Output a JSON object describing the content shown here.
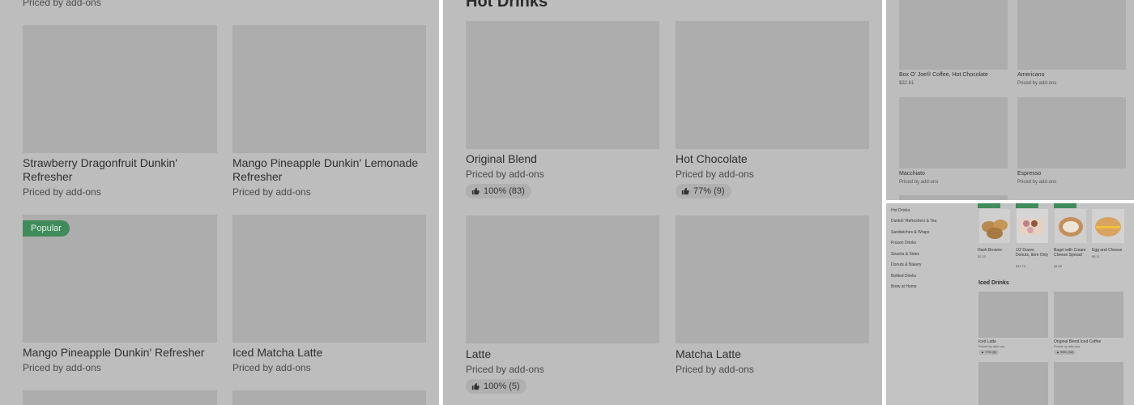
{
  "panel1": {
    "top_sub": "Priced by add-ons",
    "items": [
      {
        "name": "Strawberry Dragonfruit Dunkin' Refresher",
        "price": "Priced by add-ons"
      },
      {
        "name": "Mango Pineapple Dunkin' Lemonade Refresher",
        "price": "Priced by add-ons"
      },
      {
        "name": "Mango Pineapple Dunkin' Refresher",
        "price": "Priced by add-ons",
        "badge": "Popular"
      },
      {
        "name": "Iced Matcha Latte",
        "price": "Priced by add-ons"
      }
    ]
  },
  "panel2": {
    "section_title": "Hot Drinks",
    "items": [
      {
        "name": "Original Blend",
        "price": "Priced by add-ons",
        "rating": "100% (83)"
      },
      {
        "name": "Hot Chocolate",
        "price": "Priced by add-ons",
        "rating": "77% (9)"
      },
      {
        "name": "Latte",
        "price": "Priced by add-ons",
        "rating": "100% (5)"
      },
      {
        "name": "Matcha Latte",
        "price": "Priced by add-ons"
      }
    ]
  },
  "panel3": {
    "items": [
      {
        "name": "Box O' Joe® Coffee, Hot Chocolate",
        "price": "$32.61"
      },
      {
        "name": "Americano",
        "price": "Priced by add-ons"
      },
      {
        "name": "Macchiato",
        "price": "Priced by add-ons"
      },
      {
        "name": "Espresso",
        "price": "Priced by add-ons"
      }
    ]
  },
  "panel4": {
    "categories": [
      "Hot Drinks",
      "Dunkin' Refreshers & Tea",
      "Sandwiches & Wraps",
      "Frozen Drinks",
      "Snacks & Sides",
      "Donuts & Bakery",
      "Bottled Drinks",
      "Brew at Home"
    ],
    "top_items": [
      {
        "name": "Hash Browns",
        "price": "$2.23"
      },
      {
        "name": "1/2 Dozen Donuts, Item Only",
        "price": "$11.73"
      },
      {
        "name": "Bagel with Cream Cheese Spread",
        "price": "$4.85"
      },
      {
        "name": "Egg and Cheese",
        "price": "$5.11"
      }
    ],
    "section_title": "Iced Drinks",
    "iced_items": [
      {
        "name": "Iced Latte",
        "price": "Priced by add-ons",
        "rating": "77% (8)"
      },
      {
        "name": "Original Blend Iced Coffee",
        "price": "Priced by add-ons",
        "rating": "96% (32)"
      }
    ]
  },
  "colors": {
    "badge": "#3f8c5a",
    "overlay": "#bdbdbd",
    "placeholder": "#adadad"
  },
  "icons": {
    "rating": "thumbs-up-icon"
  }
}
